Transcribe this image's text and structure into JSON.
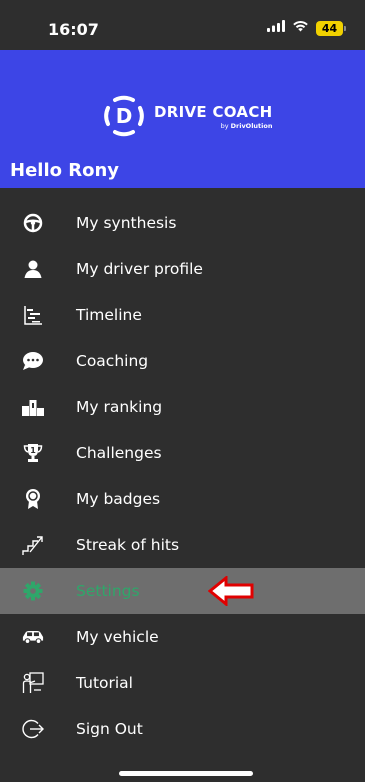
{
  "status_bar": {
    "time": "16:07",
    "battery": "44",
    "icons": [
      "signal-icon",
      "wifi-icon",
      "battery-icon"
    ]
  },
  "header": {
    "brand": "DRIVE COACH",
    "brand_by_prefix": "by ",
    "brand_by_name": "DrivOlution",
    "greeting": "Hello Rony"
  },
  "menu": {
    "items": [
      {
        "label": "My synthesis",
        "icon": "steering-wheel-icon"
      },
      {
        "label": "My driver profile",
        "icon": "person-icon"
      },
      {
        "label": "Timeline",
        "icon": "timeline-icon"
      },
      {
        "label": "Coaching",
        "icon": "chat-bubble-icon"
      },
      {
        "label": "My ranking",
        "icon": "podium-icon"
      },
      {
        "label": "Challenges",
        "icon": "trophy-icon"
      },
      {
        "label": "My badges",
        "icon": "badge-icon"
      },
      {
        "label": "Streak of hits",
        "icon": "stairs-icon"
      },
      {
        "label": "Settings",
        "icon": "gear-icon",
        "active": true
      },
      {
        "label": "My vehicle",
        "icon": "car-icon"
      },
      {
        "label": "Tutorial",
        "icon": "tutorial-icon"
      },
      {
        "label": "Sign Out",
        "icon": "sign-out-icon"
      }
    ]
  },
  "colors": {
    "header_bg": "#3d45e6",
    "drawer_bg": "#2e2e2e",
    "active_bg": "#6e6e6e",
    "active_text": "#2fa66a",
    "battery": "#f1d100",
    "annotation_arrow": "#e00000"
  }
}
